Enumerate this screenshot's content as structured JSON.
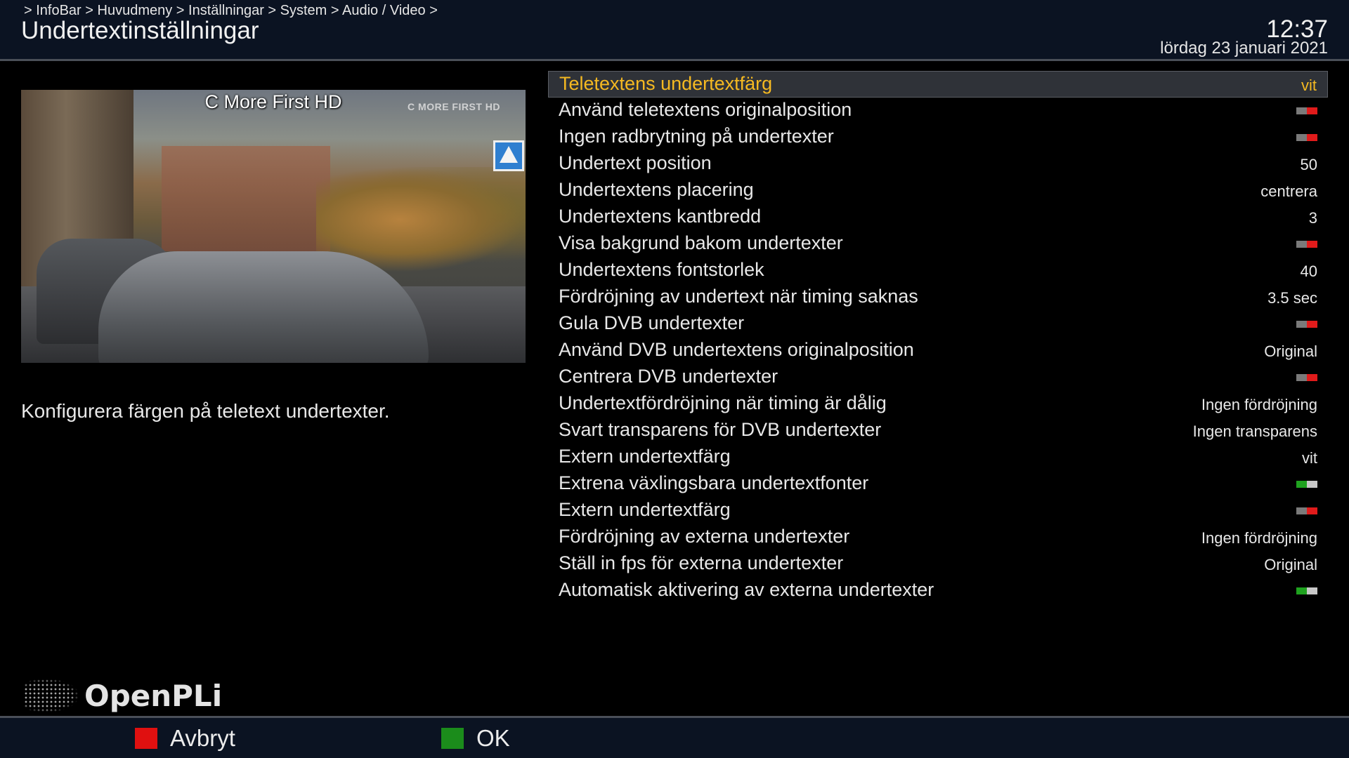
{
  "header": {
    "breadcrumb": " > InfoBar > Huvudmeny > Inställningar > System > Audio / Video >",
    "title": "Undertextinställningar",
    "time": "12:37",
    "date": "lördag 23 januari 2021"
  },
  "preview": {
    "channel_name": "C More First HD",
    "channel_logo": "C MORE FIRST HD"
  },
  "description": "Konfigurera färgen på teletext undertexter.",
  "colors": {
    "selected_text": "#f5b921",
    "toggle_off": "#e11b1b",
    "toggle_on": "#1fa21f",
    "key_red": "#e01010",
    "key_green": "#1b8c1b"
  },
  "settings": [
    {
      "label": "Teletextens undertextfärg",
      "type": "text",
      "value": "vit",
      "selected": true
    },
    {
      "label": "Använd teletextens originalposition",
      "type": "toggle",
      "value": "off"
    },
    {
      "label": "Ingen radbrytning på undertexter",
      "type": "toggle",
      "value": "off"
    },
    {
      "label": "Undertext position",
      "type": "text",
      "value": "50"
    },
    {
      "label": "Undertextens placering",
      "type": "text",
      "value": "centrera"
    },
    {
      "label": "Undertextens kantbredd",
      "type": "text",
      "value": "3"
    },
    {
      "label": "Visa bakgrund bakom undertexter",
      "type": "toggle",
      "value": "off"
    },
    {
      "label": "Undertextens fontstorlek",
      "type": "text",
      "value": "40"
    },
    {
      "label": "Fördröjning av undertext när timing saknas",
      "type": "text",
      "value": "3.5 sec"
    },
    {
      "label": "Gula DVB undertexter",
      "type": "toggle",
      "value": "off"
    },
    {
      "label": "Använd DVB undertextens originalposition",
      "type": "text",
      "value": "Original"
    },
    {
      "label": "Centrera DVB undertexter",
      "type": "toggle",
      "value": "off"
    },
    {
      "label": "Undertextfördröjning när timing är dålig",
      "type": "text",
      "value": "Ingen fördröjning"
    },
    {
      "label": "Svart transparens för DVB undertexter",
      "type": "text",
      "value": "Ingen transparens"
    },
    {
      "label": "Extern undertextfärg",
      "type": "text",
      "value": "vit"
    },
    {
      "label": "Extrena växlingsbara undertextfonter",
      "type": "toggle",
      "value": "on"
    },
    {
      "label": "Extern undertextfärg",
      "type": "toggle",
      "value": "off"
    },
    {
      "label": "Fördröjning av externa undertexter",
      "type": "text",
      "value": "Ingen fördröjning"
    },
    {
      "label": "Ställ in fps för externa undertexter",
      "type": "text",
      "value": "Original"
    },
    {
      "label": "Automatisk aktivering av externa undertexter",
      "type": "toggle",
      "value": "on"
    }
  ],
  "logo": {
    "text": "OpenPLi",
    "icon": "world-map-icon"
  },
  "footer": {
    "red_label": "Avbryt",
    "green_label": "OK"
  }
}
